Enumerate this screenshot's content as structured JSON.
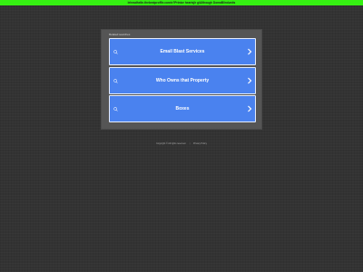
{
  "banner": {
    "text": "leheadhelln.thebestproffle.com/v?Printor heartsjlr glAlthough DomaBlindunits"
  },
  "panel": {
    "title": "Related searches",
    "links": [
      {
        "label": "Email Blast Services",
        "icon": "search-icon",
        "arrow": "chevron-right-icon"
      },
      {
        "label": "Who Owns that Property",
        "icon": "search-icon",
        "arrow": "chevron-right-icon"
      },
      {
        "label": "Boxes",
        "icon": "search-icon",
        "arrow": "chevron-right-icon"
      }
    ]
  },
  "footer": {
    "copyright": "Copyright © All rights reserved.",
    "separator": "|",
    "privacy_label": "Privacy Policy"
  },
  "colors": {
    "background": "#333333",
    "banner": "#35f012",
    "panel": "#555555",
    "button": "#4a82ef",
    "button_border": "#e4ecfb"
  }
}
